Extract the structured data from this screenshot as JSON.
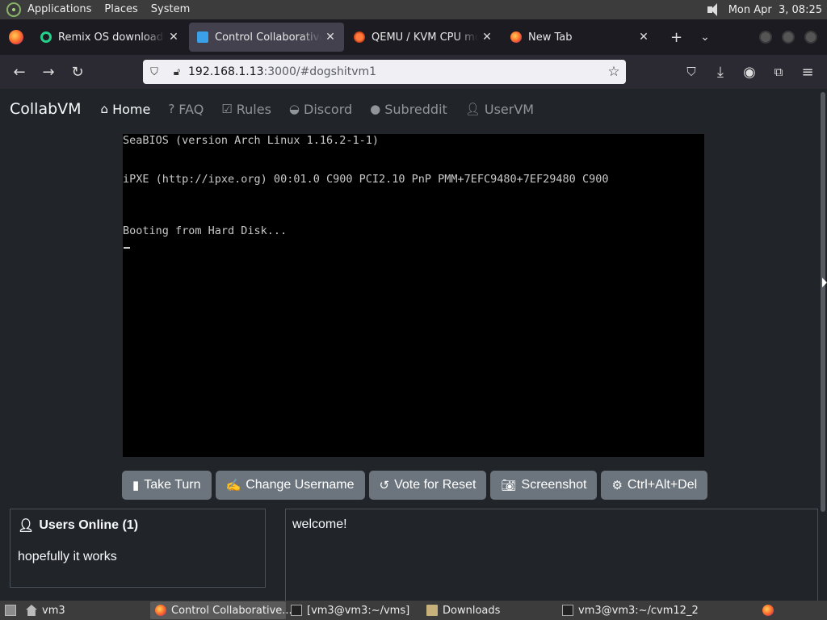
{
  "top_panel": {
    "menus": [
      "Applications",
      "Places",
      "System"
    ],
    "clock": "Mon Apr  3, 08:25"
  },
  "browser": {
    "tabs": [
      {
        "title": "Remix OS download la",
        "favicon": "remix-icon",
        "active": false
      },
      {
        "title": "Control Collaborative V",
        "favicon": "monitor-icon",
        "active": true
      },
      {
        "title": "QEMU / KVM CPU mo",
        "favicon": "qemu-icon",
        "active": false
      },
      {
        "title": "New Tab",
        "favicon": "firefox-icon",
        "active": false
      }
    ],
    "url_host": "192.168.1.13",
    "url_rest": ":3000/#dogshitvm1"
  },
  "site": {
    "brand": "CollabVM",
    "nav": [
      {
        "label": "Home",
        "icon": "home-icon"
      },
      {
        "label": "FAQ",
        "icon": "question-icon"
      },
      {
        "label": "Rules",
        "icon": "clipboard-check-icon"
      },
      {
        "label": "Discord",
        "icon": "discord-icon"
      },
      {
        "label": "Subreddit",
        "icon": "reddit-icon"
      },
      {
        "label": "UserVM",
        "icon": "user-icon"
      }
    ]
  },
  "vm_console": {
    "lines": [
      "SeaBIOS (version Arch Linux 1.16.2-1-1)",
      "iPXE (http://ipxe.org) 00:01.0 C900 PCI2.10 PnP PMM+7EFC9480+7EF29480 C900",
      "Booting from Hard Disk..."
    ]
  },
  "vm_buttons": {
    "take_turn": "Take Turn",
    "change_username": "Change Username",
    "vote_reset": "Vote for Reset",
    "screenshot": "Screenshot",
    "ctrl_alt_del": "Ctrl+Alt+Del"
  },
  "users": {
    "header": "Users Online (1)",
    "list": [
      "hopefully it works"
    ]
  },
  "chat": {
    "messages": [
      "welcome!"
    ]
  },
  "taskbar": {
    "items": [
      {
        "label": "vm3",
        "icon": "home-folder-icon"
      },
      {
        "label": "Control Collaborative...",
        "icon": "firefox-icon",
        "active": true
      },
      {
        "label": "[vm3@vm3:~/vms]",
        "icon": "terminal-icon"
      },
      {
        "label": "Downloads",
        "icon": "folder-icon"
      },
      {
        "label": "vm3@vm3:~/cvm12_2",
        "icon": "terminal-icon"
      }
    ]
  }
}
